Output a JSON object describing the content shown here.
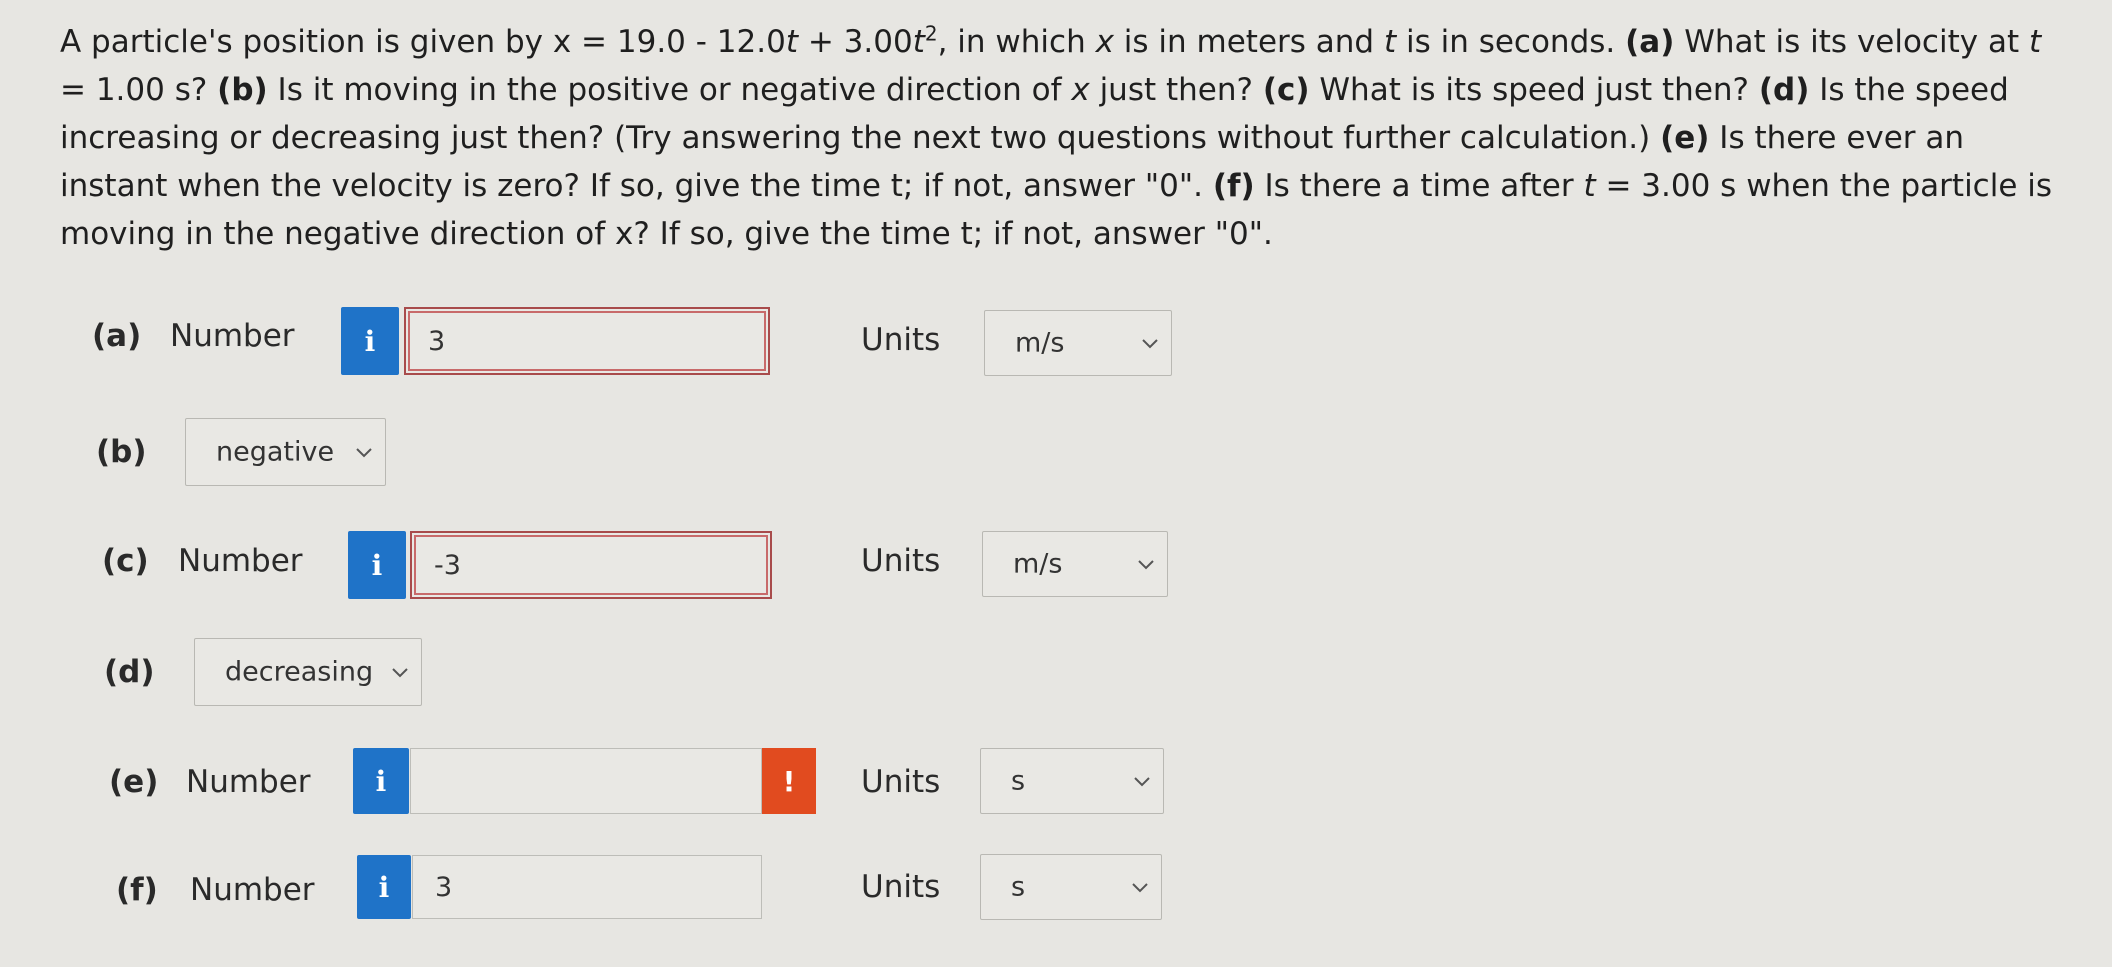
{
  "question": {
    "p1": "A particle's position is given by x = 19.0 - 12.0",
    "t1": "t",
    "p2": " + 3.00",
    "t2": "t",
    "sup2": "2",
    "p3": ", in which ",
    "x1": "x",
    "p4": " is in meters and ",
    "t3": "t",
    "p5": " is in seconds. ",
    "a_tag": "(a)",
    "a_text": " What is its velocity at ",
    "t4": "t",
    "a_text2": " = 1.00 s? ",
    "b_tag": "(b)",
    "b_text": " Is it moving in the positive or negative direction of ",
    "x2": "x",
    "b_text2": " just then? ",
    "c_tag": "(c)",
    "c_text": " What is its speed just then? ",
    "d_tag": "(d)",
    "d_text": " Is the speed increasing or decreasing just then? (Try answering the next two questions without further calculation.) ",
    "e_tag": "(e)",
    "e_text": " Is there ever an instant when the velocity is zero? If so, give the time t; if not, answer \"0\". ",
    "f_tag": "(f)",
    "f_text": " Is there a time after ",
    "t5": "t",
    "f_text2": " = 3.00 s when the particle is moving in the negative direction of x? If so, give the time t; if not, answer \"0\"."
  },
  "rows": {
    "a": {
      "label": "(a)",
      "word": "Number",
      "info": "i",
      "value": "3",
      "units_label": "Units",
      "units": "m/s"
    },
    "b": {
      "label": "(b)",
      "select": "negative"
    },
    "c": {
      "label": "(c)",
      "word": "Number",
      "info": "i",
      "value": "-3",
      "units_label": "Units",
      "units": "m/s"
    },
    "d": {
      "label": "(d)",
      "select": "decreasing"
    },
    "e": {
      "label": "(e)",
      "word": "Number",
      "info": "i",
      "value": "",
      "alert": "!",
      "units_label": "Units",
      "units": "s"
    },
    "f": {
      "label": "(f)",
      "word": "Number",
      "info": "i",
      "value": "3",
      "units_label": "Units",
      "units": "s"
    }
  },
  "colors": {
    "info": "#1f73c8",
    "alert": "#e14b1f",
    "error_border": "#a84b4b",
    "bg": "#e7e6e2"
  }
}
